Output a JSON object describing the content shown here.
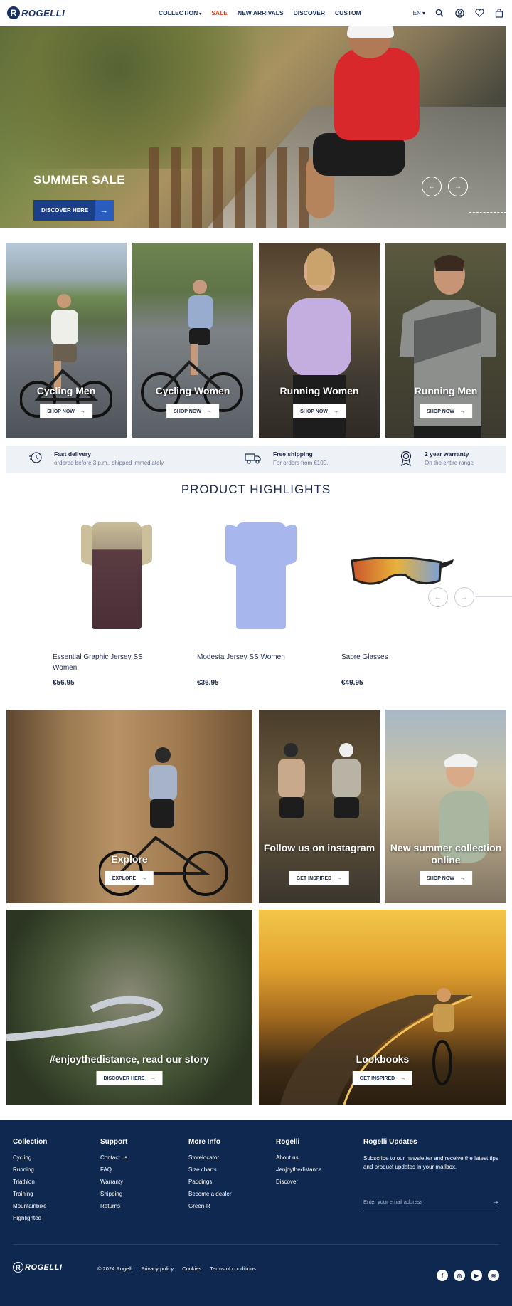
{
  "header": {
    "logo_letter": "R",
    "logo_text": "ROGELLI",
    "nav": [
      {
        "label": "COLLECTION",
        "caret": "▾"
      },
      {
        "label": "SALE"
      },
      {
        "label": "NEW ARRIVALS"
      },
      {
        "label": "DISCOVER"
      },
      {
        "label": "CUSTOM"
      }
    ],
    "language": "EN ▾"
  },
  "hero": {
    "title": "SUMMER SALE",
    "button_label": "DISCOVER HERE",
    "arrow": "→",
    "prev": "←",
    "next": "→"
  },
  "category_tiles": [
    {
      "label": "Cycling Men",
      "button": "SHOP NOW"
    },
    {
      "label": "Cycling Women",
      "button": "SHOP NOW"
    },
    {
      "label": "Running Women",
      "button": "SHOP NOW"
    },
    {
      "label": "Running Men",
      "button": "SHOP NOW"
    }
  ],
  "usps": [
    {
      "title": "Fast delivery",
      "subtitle": "ordered before 3 p.m., shipped immediately",
      "icon": "clock-delivery-icon"
    },
    {
      "title": "Free shipping",
      "subtitle": "For orders from €100,-",
      "icon": "truck-icon"
    },
    {
      "title": "2 year warranty",
      "subtitle": "On the entire range",
      "icon": "award-icon"
    }
  ],
  "highlights": {
    "title": "PRODUCT HIGHLIGHTS",
    "products": [
      {
        "name": "Essential Graphic Jersey SS Women",
        "price": "€56.95"
      },
      {
        "name": "Modesta Jersey SS Women",
        "price": "€36.95"
      },
      {
        "name": "Sabre Glasses",
        "price": "€49.95"
      }
    ],
    "prev": "←",
    "next": "→"
  },
  "explore_tiles": [
    {
      "label": "Explore",
      "button": "EXPLORE"
    },
    {
      "label": "Follow us on instagram",
      "button": "GET INSPIRED"
    },
    {
      "label": "New summer collection online",
      "button": "SHOP NOW"
    },
    {
      "label": "#enjoythedistance, read our story",
      "button": "DISCOVER HERE"
    },
    {
      "label": "Lookbooks",
      "button": "GET INSPIRED"
    }
  ],
  "footer": {
    "columns": [
      {
        "title": "Collection",
        "items": [
          "Cycling",
          "Running",
          "Triathlon",
          "Training",
          "Mountainbike",
          "Highlighted"
        ]
      },
      {
        "title": "Support",
        "items": [
          "Contact us",
          "FAQ",
          "Warranty",
          "Shipping",
          "Returns"
        ]
      },
      {
        "title": "More Info",
        "items": [
          "Storelocator",
          "Size charts",
          "Paddings",
          "Become a dealer",
          "Green-R"
        ]
      },
      {
        "title": "Rogelli",
        "items": [
          "About us",
          "#enjoythedistance",
          "Discover"
        ]
      }
    ],
    "newsletter": {
      "title": "Rogelli Updates",
      "text": "Subscribe to our newsletter and receive the latest tips and product updates in your mailbox.",
      "placeholder": "Enter your email address",
      "arrow": "→"
    },
    "logo_letter": "R",
    "logo_text": "ROGELLI",
    "copyright": "© 2024 Rogelli",
    "links": [
      "Privacy policy",
      "Cookies",
      "Terms of conditions"
    ],
    "social": [
      {
        "icon": "facebook-icon",
        "glyph": "f"
      },
      {
        "icon": "instagram-icon",
        "glyph": "◎"
      },
      {
        "icon": "youtube-icon",
        "glyph": "▶"
      },
      {
        "icon": "spotify-icon",
        "glyph": "≋"
      }
    ]
  },
  "colors": {
    "brand_navy": "#0e2850",
    "accent_blue": "#1c3f8a",
    "sale_orange": "#d9481f"
  }
}
